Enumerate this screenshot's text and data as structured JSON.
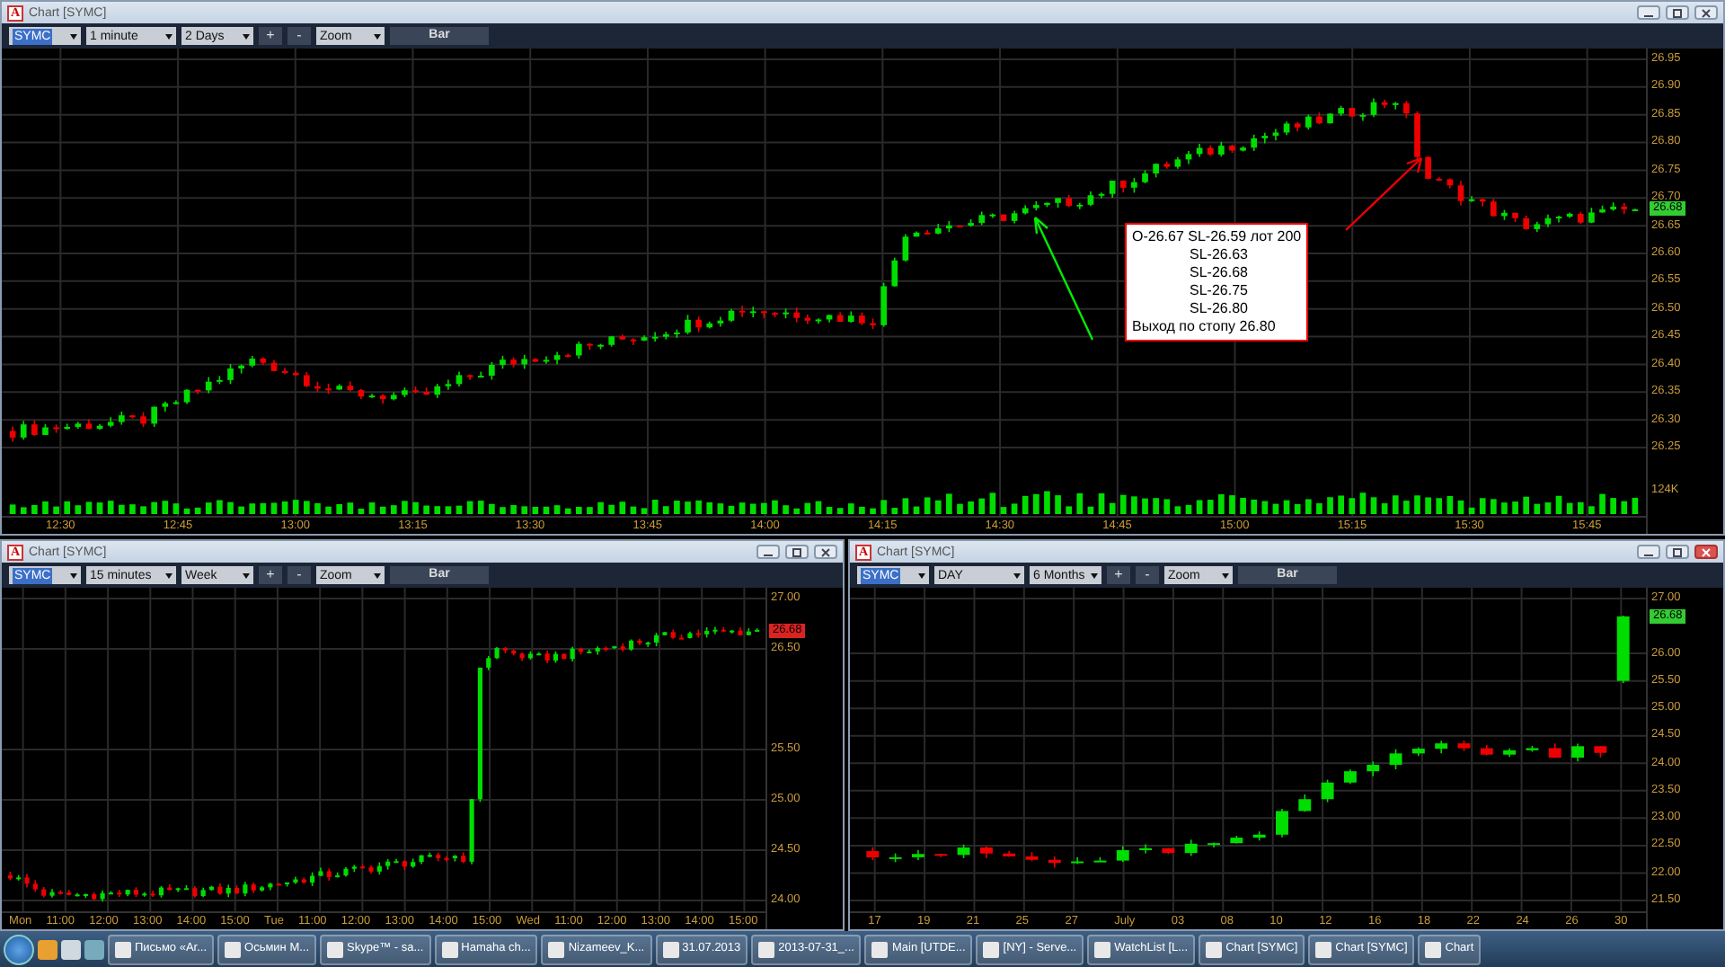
{
  "windows": [
    {
      "title": "Chart [SYMC]",
      "logo": "A",
      "active": false,
      "symbol": "SYMC",
      "interval": "1 minute",
      "range": "2 Days",
      "plus": "+",
      "minus": "-",
      "zoom": "Zoom",
      "chart_type": "Bar",
      "price_ticks": [
        "26.95",
        "26.90",
        "26.85",
        "26.80",
        "26.75",
        "26.70",
        "26.65",
        "26.60",
        "26.55",
        "26.50",
        "26.45",
        "26.40",
        "26.35",
        "26.30",
        "26.25"
      ],
      "current_price": {
        "text": "26.68",
        "up": true
      },
      "volume_label": "124K",
      "time_ticks": [
        "12:30",
        "12:45",
        "13:00",
        "13:15",
        "13:30",
        "13:45",
        "14:00",
        "14:15",
        "14:30",
        "14:45",
        "15:00",
        "15:15",
        "15:30",
        "15:45"
      ],
      "note": {
        "lines": [
          {
            "text": "O-26.67 SL-26.59 лот 200",
            "indented": false
          },
          {
            "text": "SL-26.63",
            "indented": true
          },
          {
            "text": "SL-26.68",
            "indented": true
          },
          {
            "text": "SL-26.75",
            "indented": true
          },
          {
            "text": "SL-26.80",
            "indented": true
          },
          {
            "text": "Выход по стопу 26.80",
            "indented": false
          }
        ]
      }
    },
    {
      "title": "Chart [SYMC]",
      "logo": "A",
      "active": false,
      "symbol": "SYMC",
      "interval": "15 minutes",
      "range": "Week",
      "plus": "+",
      "minus": "-",
      "zoom": "Zoom",
      "chart_type": "Bar",
      "price_ticks": [
        "27.00",
        "26.50",
        "25.50",
        "25.00",
        "24.50",
        "24.00"
      ],
      "current_price": {
        "text": "26.68",
        "up": false
      },
      "time_ticks": [
        "Mon",
        "11:00",
        "12:00",
        "13:00",
        "14:00",
        "15:00",
        "Tue",
        "11:00",
        "12:00",
        "13:00",
        "14:00",
        "15:00",
        "Wed",
        "11:00",
        "12:00",
        "13:00",
        "14:00",
        "15:00"
      ]
    },
    {
      "title": "Chart [SYMC]",
      "logo": "A",
      "active": true,
      "symbol": "SYMC",
      "interval": "DAY",
      "range": "6 Months",
      "plus": "+",
      "minus": "-",
      "zoom": "Zoom",
      "chart_type": "Bar",
      "price_ticks": [
        "27.00",
        "26.00",
        "25.50",
        "25.00",
        "24.50",
        "24.00",
        "23.50",
        "23.00",
        "22.50",
        "22.00",
        "21.50"
      ],
      "current_price": {
        "text": "26.68",
        "up": true
      },
      "time_ticks": [
        "17",
        "19",
        "21",
        "25",
        "27",
        "July",
        "03",
        "08",
        "10",
        "12",
        "16",
        "18",
        "22",
        "24",
        "26",
        "30"
      ]
    }
  ],
  "taskbar": {
    "items": [
      {
        "label": "Письмо «Ar..."
      },
      {
        "label": "Осьмин М..."
      },
      {
        "label": "Skype™ - sa..."
      },
      {
        "label": "Hamaha ch..."
      },
      {
        "label": "Nizameev_K..."
      },
      {
        "label": "31.07.2013"
      },
      {
        "label": "2013-07-31_..."
      },
      {
        "label": "Main [UTDE..."
      },
      {
        "label": "[NY] - Serve..."
      },
      {
        "label": "WatchList [L..."
      },
      {
        "label": "Chart [SYMC]"
      },
      {
        "label": "Chart [SYMC]"
      },
      {
        "label": "Chart"
      }
    ]
  }
}
